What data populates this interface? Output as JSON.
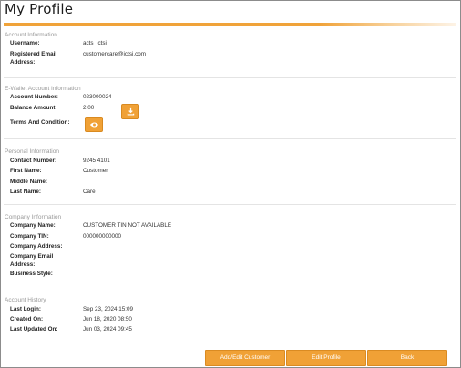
{
  "page": {
    "title": "My Profile"
  },
  "account_info": {
    "section_title": "Account Information",
    "username_label": "Username:",
    "username_value": "acts_ictsi",
    "email_label_line1": "Registered Email",
    "email_label_line2": "Address:",
    "email_value": "customercare@ictsi.com"
  },
  "ewallet": {
    "section_title": "E-Wallet Account Information",
    "account_number_label": "Account Number:",
    "account_number_value": "023000024",
    "balance_label": "Balance Amount:",
    "balance_value": "2.00",
    "terms_label": "Terms And Condition:",
    "download_icon": "download-icon",
    "view_icon": "eye-icon"
  },
  "personal": {
    "section_title": "Personal Information",
    "contact_label": "Contact Number:",
    "contact_value": "9245 4101",
    "first_label": "First Name:",
    "first_value": "Customer",
    "middle_label": "Middle Name:",
    "middle_value": "",
    "last_label": "Last Name:",
    "last_value": "Care"
  },
  "company": {
    "section_title": "Company Information",
    "name_label": "Company Name:",
    "name_value": "CUSTOMER TIN NOT AVAILABLE",
    "tin_label": "Company TIN:",
    "tin_value": "000000000000",
    "address_label": "Company Address:",
    "address_value": "",
    "email_label_line1": "Company Email",
    "email_label_line2": "Address:",
    "email_value": "",
    "style_label": "Business Style:",
    "style_value": ""
  },
  "history": {
    "section_title": "Account History",
    "last_login_label": "Last Login:",
    "last_login_value": "Sep 23, 2024 15:09",
    "created_label": "Created On:",
    "created_value": "Jun 18, 2020 08:50",
    "updated_label": "Last Updated On:",
    "updated_value": "Jun 03, 2024 09:45"
  },
  "footer": {
    "add_edit_customer": "Add/Edit Customer",
    "edit_profile": "Edit Profile",
    "back": "Back"
  },
  "colors": {
    "accent": "#f0a136",
    "section_title": "#9a9a9a"
  }
}
